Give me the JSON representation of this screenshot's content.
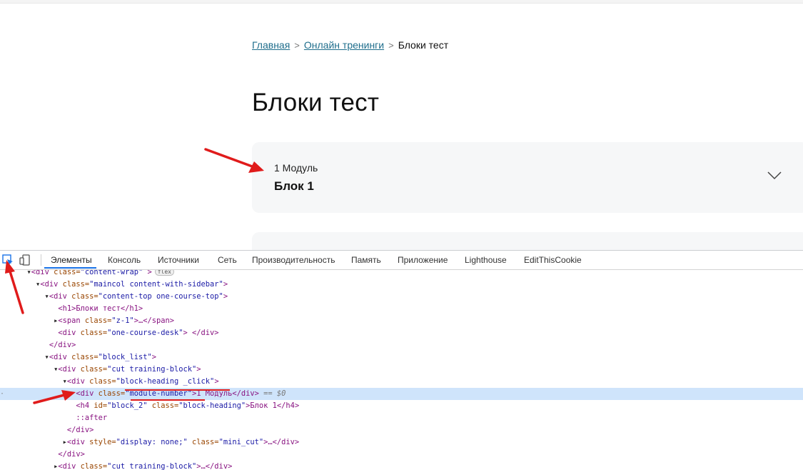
{
  "breadcrumb": {
    "home": "Главная",
    "section": "Онлайн тренинги",
    "current": "Блоки тест",
    "separator": ">"
  },
  "page_title": "Блоки тест",
  "card": {
    "module_number": "1 Модуль",
    "block_title": "Блок 1"
  },
  "devtools": {
    "tabs": [
      "Элементы",
      "Консоль",
      "Источники",
      "Сеть",
      "Производительность",
      "Память",
      "Приложение",
      "Lighthouse",
      "EditThisCookie"
    ],
    "active_tab": "Элементы",
    "flex_badge": "flex",
    "lines": [
      {
        "pre": "      ▾",
        "tag_open": "<div ",
        "attr": "class=",
        "val": "\"content-wrap\"",
        "close": " >",
        "badge": true
      },
      {
        "pre": "        ▾",
        "tag_open": "<div ",
        "attr": "class=",
        "val": "\"maincol content-with-sidebar\"",
        "close": ">"
      },
      {
        "pre": "          ▾",
        "tag_open": "<div ",
        "attr": "class=",
        "val": "\"content-top one-course-top\"",
        "close": ">"
      },
      {
        "pre": "             ",
        "raw": "<h1>Блоки тест</h1>"
      },
      {
        "pre": "            ▸",
        "tag_open": "<span ",
        "attr": "class=",
        "val": "\"z-1\"",
        "close": ">…</span>"
      },
      {
        "pre": "             ",
        "tag_open": "<div ",
        "attr": "class=",
        "val": "\"one-course-desk\"",
        "close": "> </div>"
      },
      {
        "pre": "           ",
        "raw": "</div>"
      },
      {
        "pre": "          ▾",
        "tag_open": "<div ",
        "attr": "class=",
        "val": "\"block_list\"",
        "close": ">"
      },
      {
        "pre": "            ▾",
        "tag_open": "<div ",
        "attr": "class=",
        "val": "\"cut training-block\"",
        "close": ">"
      },
      {
        "pre": "              ▾",
        "tag_open": "<div ",
        "attr": "class=",
        "val": "\"block-heading _click\"",
        "close": ">"
      },
      {
        "pre": "                 ",
        "tag_open": "<div ",
        "attr": "class=",
        "val": "\"module-number\"",
        "close": ">1 Модуль</div>",
        "eq": " == $0",
        "selected": true
      },
      {
        "pre": "                 ",
        "tag_open": "<h4 ",
        "attr": "id=",
        "val": "\"block_2\"",
        "attr2": " class=",
        "val2": "\"block-heading\"",
        "close": ">Блок 1</h4>"
      },
      {
        "pre": "                 ",
        "pseudo": "::after"
      },
      {
        "pre": "               ",
        "raw": "</div>"
      },
      {
        "pre": "              ▸",
        "tag_open": "<div ",
        "attr": "style=",
        "val": "\"display: none;\"",
        "attr2": " class=",
        "val2": "\"mini_cut\"",
        "close": ">…</div>"
      },
      {
        "pre": "             ",
        "raw": "</div>"
      },
      {
        "pre": "            ▸",
        "tag_open": "<div ",
        "attr": "class=",
        "val": "\"cut training-block\"",
        "close": ">…</div>"
      }
    ]
  },
  "colors": {
    "link": "#1f6e8c",
    "card_bg": "#f6f7f8",
    "selected_row": "#cfe4fb",
    "annotation_red": "#e01b1b",
    "devtools_accent": "#1a73e8"
  }
}
